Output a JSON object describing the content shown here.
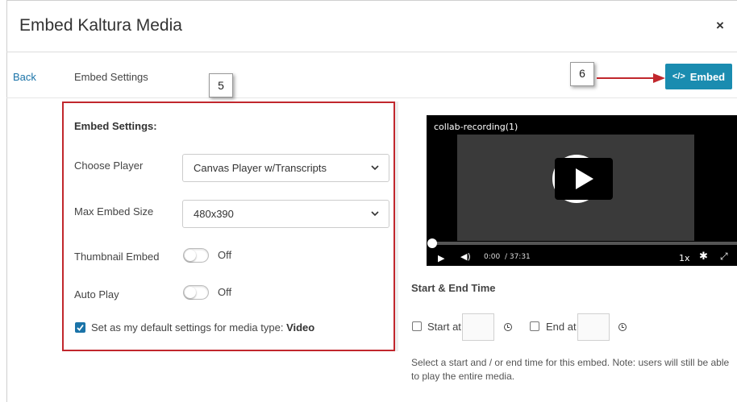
{
  "modal": {
    "title": "Embed Kaltura Media",
    "close_glyph": "×"
  },
  "nav": {
    "back_label": "Back",
    "crumb": "Embed Settings"
  },
  "callouts": {
    "step5": "5",
    "step6": "6"
  },
  "toolbar": {
    "embed_icon": "</>",
    "embed_label": "Embed",
    "embed_color": "#1a8cb0"
  },
  "settings": {
    "title": "Embed Settings:",
    "highlight_color": "#c1272d",
    "player_label": "Choose Player",
    "player_value": "Canvas Player w/Transcripts",
    "size_label": "Max Embed Size",
    "size_value": "480x390",
    "thumbnail_label": "Thumbnail Embed",
    "thumbnail_state": "Off",
    "autoplay_label": "Auto Play",
    "autoplay_state": "Off",
    "default_label": "Set as my default settings for media type: ",
    "default_media_type": "Video",
    "default_checked": true
  },
  "player": {
    "media_title": "collab-recording(1)",
    "current_time": "0:00",
    "duration": "/ 37:31",
    "speed": "1x",
    "progress": 0
  },
  "start_end": {
    "title": "Start & End Time",
    "start_label": "Start at",
    "end_label": "End at",
    "start_value": "",
    "end_value": "",
    "note": "Select a start and / or end time for this embed. Note: users will still be able to play the entire media."
  },
  "icons": {
    "close": "close-icon",
    "embed": "code-icon",
    "select_caret": "chevron-down-icon",
    "check": "check-icon",
    "play": "play-icon",
    "volume": "volume-icon",
    "settings": "gear-icon",
    "fullscreen": "fullscreen-icon",
    "clock": "clock-icon"
  }
}
